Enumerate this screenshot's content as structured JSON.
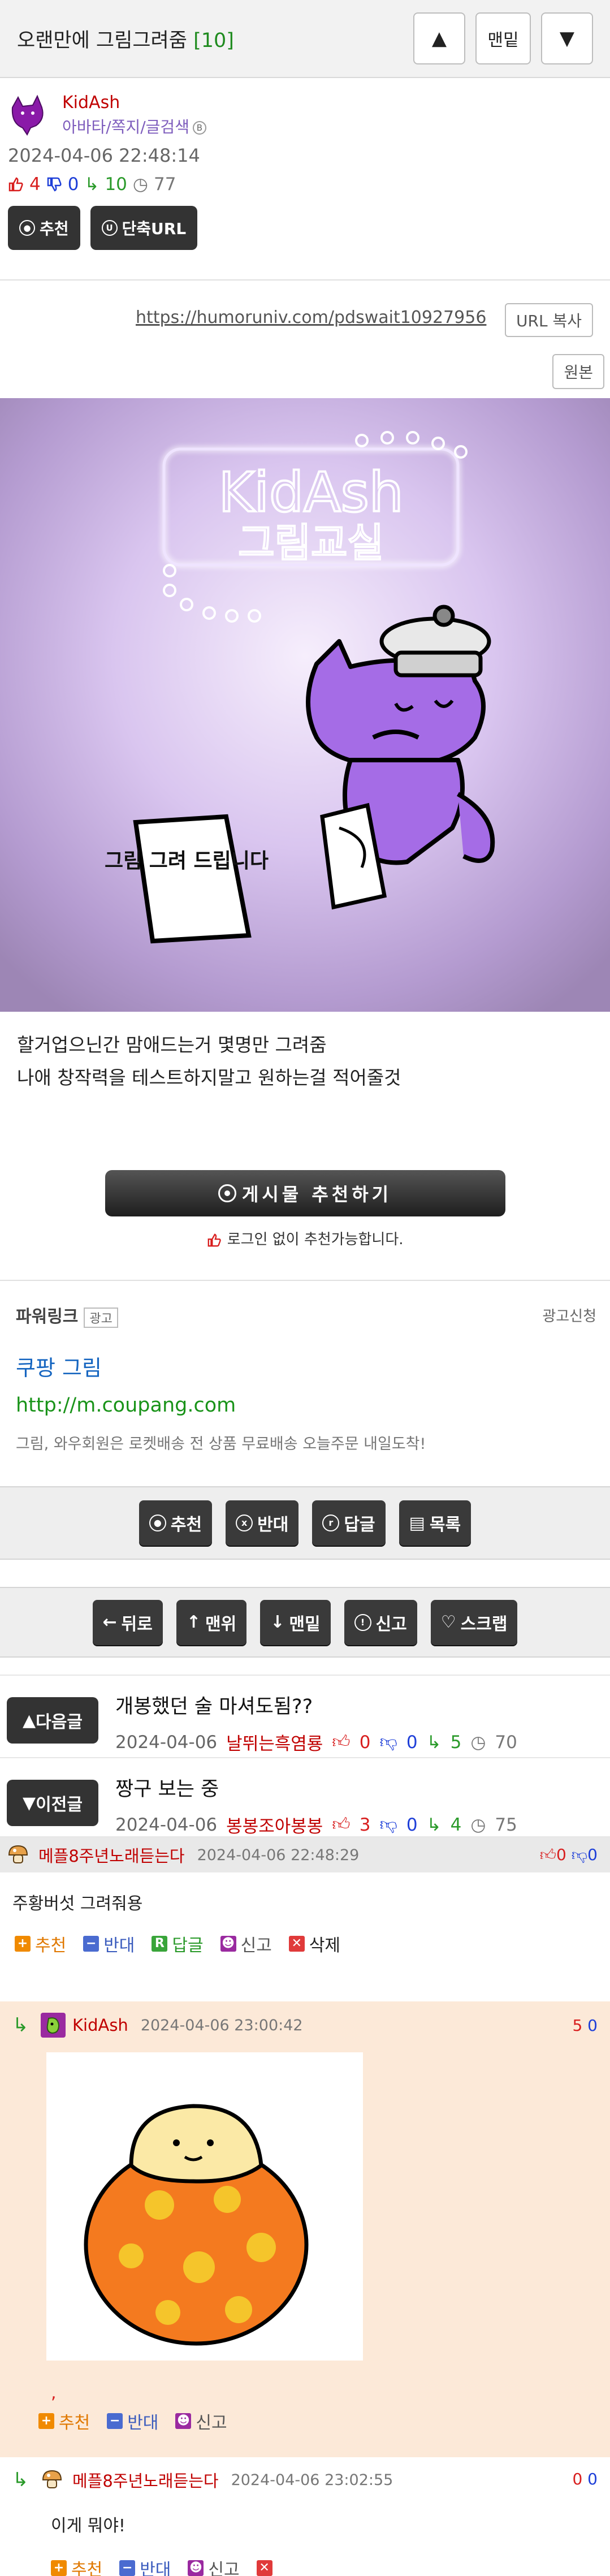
{
  "header": {
    "title": "오랜만에 그림그려줌",
    "count": "[10]",
    "up_label": "▲",
    "bottom_label": "맨밑",
    "down_label": "▼"
  },
  "author": {
    "nick": "KidAsh",
    "links": "아바타/쪽지/글검색",
    "links_badge": "B",
    "date": "2024-04-06 22:48:14",
    "up_count": "4",
    "down_count": "0",
    "reply_count": "10",
    "view_count": "77",
    "recommend_btn": "추천",
    "short_url_btn": "단축URL"
  },
  "url_bar": {
    "url": "https://humoruniv.com/pdswait10927956",
    "copy_label": "URL 복사",
    "original_label": "원본"
  },
  "image": {
    "logo_line1": "KidAsh",
    "logo_line2": "그림교실",
    "sign_text": "그림 그려 드립니다"
  },
  "body": {
    "line1": "할거업으닌간 맘애드는거 몇명만 그려줌",
    "line2": "나애 창작력을 테스트하지말고 원하는걸 적어줄것"
  },
  "recommend": {
    "big_label": "게시물 추천하기",
    "note": "로그인 없이 추천가능합니다."
  },
  "powerlink": {
    "title": "파워링크",
    "badge": "광고",
    "apply": "광고신청",
    "ad_title": "쿠팡 그림",
    "ad_url": "http://m.coupang.com",
    "ad_desc": "그림, 와우회원은 로켓배송 전 상품 무료배송 오늘주문 내일도착!"
  },
  "actions1": {
    "recommend": "추천",
    "oppose": "반대",
    "reply": "답글",
    "list": "목록"
  },
  "actions2": {
    "back": "뒤로",
    "top": "맨위",
    "bottom": "맨밑",
    "report": "신고",
    "scrap": "스크랩"
  },
  "next_post": {
    "label": "다음글",
    "title": "개봉했던 술 마셔도됨??",
    "date": "2024-04-06",
    "nick": "날뛰는흑염룡",
    "up": "0",
    "down": "0",
    "replies": "5",
    "views": "70"
  },
  "prev_post": {
    "label": "이전글",
    "title": "짱구 보는 중",
    "date": "2024-04-06",
    "nick": "봉봉조아봉봉",
    "up": "3",
    "down": "0",
    "replies": "4",
    "views": "75"
  },
  "comments": [
    {
      "nick": "메플8주년노래듣는다",
      "date": "2024-04-06 22:48:29",
      "up": "0",
      "down": "0",
      "text": "주황버섯 그려줘용",
      "recommend": "추천",
      "oppose": "반대",
      "reply": "답글",
      "report": "신고",
      "delete": "삭제"
    },
    {
      "nick": "KidAsh",
      "date": "2024-04-06 23:00:42",
      "up": "5",
      "down": "0",
      "text": ",",
      "recommend": "추천",
      "oppose": "반대",
      "report": "신고"
    },
    {
      "nick": "메플8주년노래듣는다",
      "date": "2024-04-06 23:02:55",
      "up": "0",
      "down": "0",
      "text": "이게 뭐야!",
      "recommend": "추천",
      "oppose": "반대",
      "report": "신고"
    }
  ],
  "colors": {
    "accent_green": "#1f8b1f",
    "nick_red": "#c00000",
    "link_purple": "#7e5dbd",
    "reply_bg": "#fce9d8"
  }
}
